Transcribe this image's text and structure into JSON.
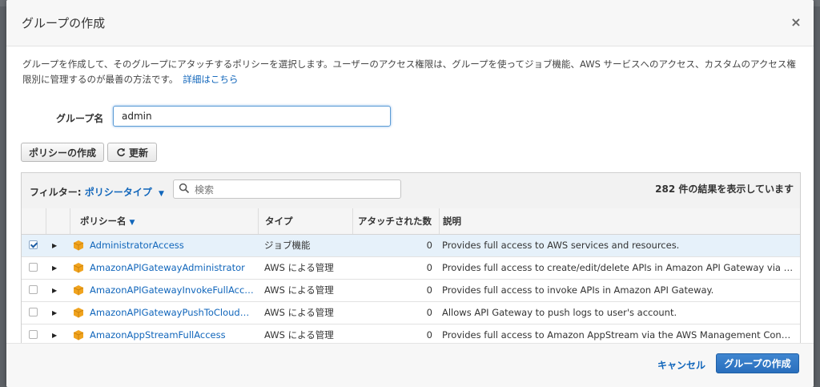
{
  "dialog": {
    "title": "グループの作成",
    "close_label": "×",
    "description": "グループを作成して、そのグループにアタッチするポリシーを選択します。ユーザーのアクセス権限は、グループを使ってジョブ機能、AWS サービスへのアクセス、カスタムのアクセス権限別に管理するのが最善の方法です。",
    "details_link": "詳細はこちら"
  },
  "group_name": {
    "label": "グループ名",
    "value": "admin"
  },
  "actions": {
    "create_policy": "ポリシーの作成",
    "refresh": "更新"
  },
  "filter": {
    "label": "フィルター:",
    "value": "ポリシータイプ",
    "search_placeholder": "検索",
    "result_count": "282 件の結果を表示しています"
  },
  "table": {
    "headers": {
      "name": "ポリシー名",
      "type": "タイプ",
      "attached": "アタッチされた数",
      "description": "説明"
    },
    "rows": [
      {
        "name": "AdministratorAccess",
        "type": "ジョブ機能",
        "attached": "0",
        "description": "Provides full access to AWS services and resources.",
        "checked": true
      },
      {
        "name": "AmazonAPIGatewayAdministrator",
        "type": "AWS による管理",
        "attached": "0",
        "description": "Provides full access to create/edit/delete APIs in Amazon API Gateway via the AWS...",
        "checked": false
      },
      {
        "name": "AmazonAPIGatewayInvokeFullAccess",
        "type": "AWS による管理",
        "attached": "0",
        "description": "Provides full access to invoke APIs in Amazon API Gateway.",
        "checked": false
      },
      {
        "name": "AmazonAPIGatewayPushToCloudW...",
        "type": "AWS による管理",
        "attached": "0",
        "description": "Allows API Gateway to push logs to user's account.",
        "checked": false
      },
      {
        "name": "AmazonAppStreamFullAccess",
        "type": "AWS による管理",
        "attached": "0",
        "description": "Provides full access to Amazon AppStream via the AWS Management Console.",
        "checked": false
      }
    ]
  },
  "footer": {
    "cancel": "キャンセル",
    "create_group": "グループの作成"
  },
  "colors": {
    "link": "#1166bb",
    "primary": "#2a6fbd",
    "selected_row": "#e6f1fa",
    "policy_icon": "#f0a31e"
  }
}
